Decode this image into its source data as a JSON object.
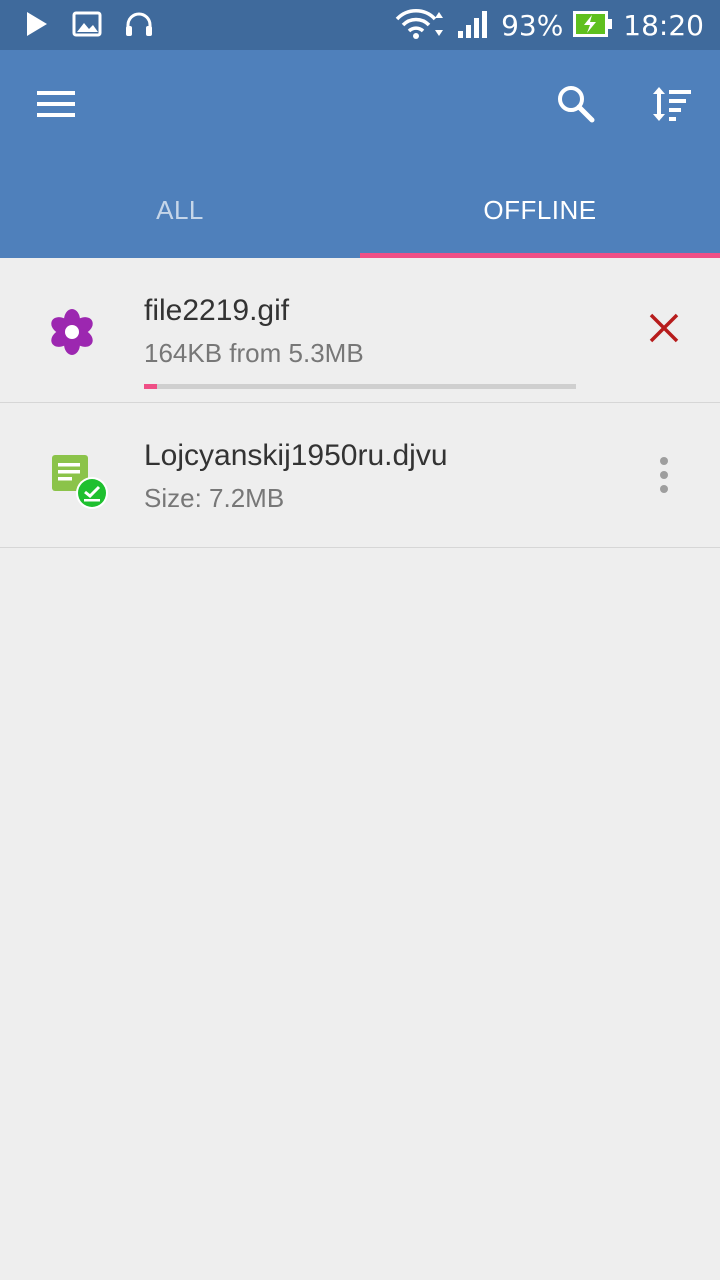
{
  "status_bar": {
    "battery": "93%",
    "time": "18:20",
    "icons": [
      "play-store-icon",
      "image-notification-icon",
      "headphones-icon",
      "wifi-icon",
      "signal-icon",
      "battery-charging-icon"
    ]
  },
  "app_bar": {
    "menu_icon": "menu-icon",
    "search_icon": "search-icon",
    "sort_icon": "sort-icon"
  },
  "tabs": [
    {
      "label": "ALL",
      "active": false
    },
    {
      "label": "OFFLINE",
      "active": true
    }
  ],
  "items": [
    {
      "icon": "image-file-icon",
      "name": "file2219.gif",
      "subtitle": "164KB from 5.3MB",
      "progress": 0.03,
      "action_icon": "cancel-icon"
    },
    {
      "icon": "document-downloaded-icon",
      "name": "Lojcyanskij1950ru.djvu",
      "subtitle": "Size: 7.2MB",
      "action_icon": "more-vert-icon"
    }
  ],
  "colors": {
    "status_bar": "#3f6a9c",
    "app_bar": "#4f80bb",
    "accent": "#ef4f86",
    "cancel": "#b71c1c",
    "gif_icon": "#9c27b0",
    "doc_icon": "#8bc34a",
    "check_badge": "#1ec02f"
  }
}
